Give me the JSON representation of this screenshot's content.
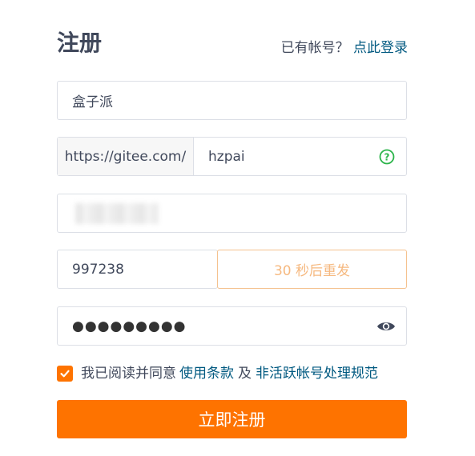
{
  "header": {
    "title": "注册",
    "login_prompt": "已有帐号？",
    "login_link": "点此登录"
  },
  "form": {
    "name_value": "盒子派",
    "path_prefix": "https://gitee.com/",
    "path_value": "hzpai",
    "path_status_icon": "check-circle-icon",
    "email_value": "",
    "code_value": "997238",
    "resend_label": "30 秒后重发",
    "password_mask": "●●●●●●●●●",
    "password_toggle_icon": "eye-icon"
  },
  "agreement": {
    "checked": true,
    "text": "我已阅读并同意",
    "terms_link": "使用条款",
    "conjunction": "及",
    "policy_link": "非活跃帐号处理规范"
  },
  "submit": {
    "label": "立即注册"
  },
  "colors": {
    "accent": "#fe7300",
    "link": "#005980",
    "success": "#2bb44a",
    "resend_text": "#f6b980"
  }
}
